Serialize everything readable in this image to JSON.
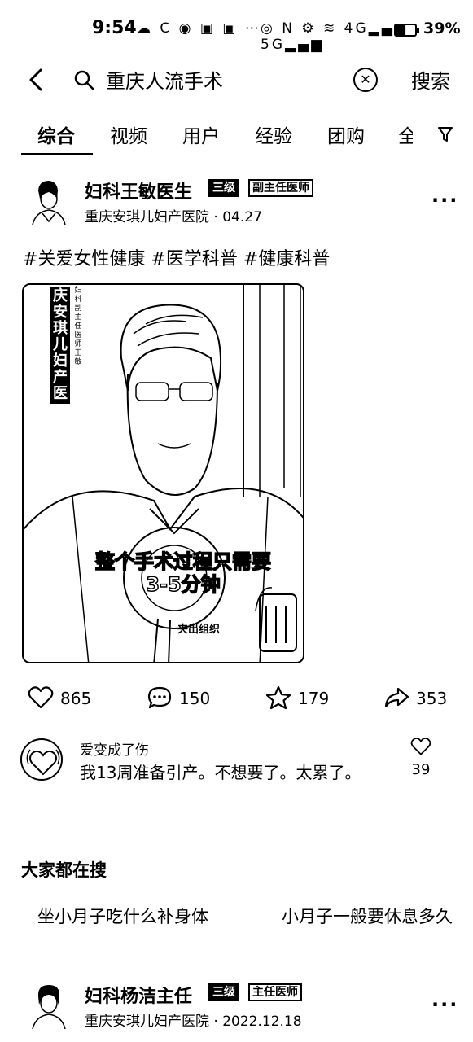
{
  "status": {
    "time": "9:54",
    "left_icons": "☁ C ◉ ▣ ▣ ⋯",
    "right_icons": "◎ N ⚙ ≋ 4G▂▄▆ 5G▂▄▆",
    "battery_fraction": 0.39,
    "battery": "39%"
  },
  "search": {
    "query": "重庆人流手术",
    "button": "搜索"
  },
  "tabs": [
    "综合",
    "视频",
    "用户",
    "经验",
    "团购"
  ],
  "tab_more": "全",
  "post1": {
    "author": "妇科王敏医生",
    "badge1": "三级",
    "badge2": "副主任医师",
    "hospital": "重庆安琪儿妇产医院",
    "date": "04.27",
    "hashtags": "#关爱女性健康 #医学科普 #健康科普",
    "video": {
      "side_title": "庆安琪儿妇产医",
      "side_sub": "妇科副主任医师 王敏",
      "caption_line1": "整个手术过程只需要",
      "caption_line2": "3-5分钟",
      "sublabel": "夹出组织"
    },
    "likes": "865",
    "comments": "150",
    "favorites": "179",
    "shares": "353"
  },
  "top_comment": {
    "user": "爱变成了伤",
    "text": "我13周准备引产。不想要了。太累了。",
    "likes": "39"
  },
  "related": {
    "title": "大家都在搜",
    "items": [
      "坐小月子吃什么补身体",
      "小月子一般要休息多久"
    ]
  },
  "post2": {
    "author": "妇科杨洁主任",
    "badge1": "三级",
    "badge2": "主任医师",
    "hospital": "重庆安琪儿妇产医院",
    "date": "2022.12.18"
  }
}
